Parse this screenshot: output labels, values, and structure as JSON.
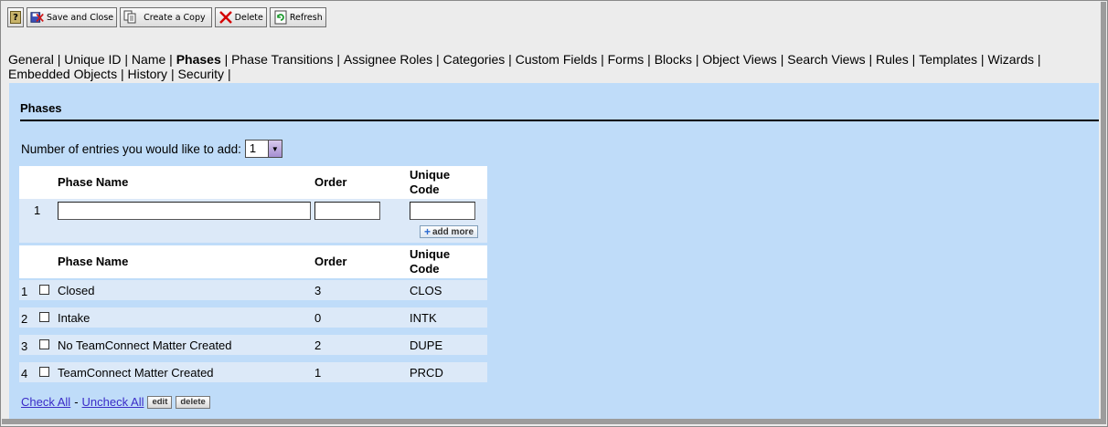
{
  "toolbar": {
    "help_label": "?",
    "save_close_label": "Save and Close",
    "create_copy_label": "Create a Copy",
    "delete_label": "Delete",
    "refresh_label": "Refresh"
  },
  "tabs": [
    {
      "label": "General",
      "active": false
    },
    {
      "label": "Unique ID",
      "active": false
    },
    {
      "label": "Name",
      "active": false
    },
    {
      "label": "Phases",
      "active": true
    },
    {
      "label": "Phase Transitions",
      "active": false
    },
    {
      "label": "Assignee Roles",
      "active": false
    },
    {
      "label": "Categories",
      "active": false
    },
    {
      "label": "Custom Fields",
      "active": false
    },
    {
      "label": "Forms",
      "active": false
    },
    {
      "label": "Blocks",
      "active": false
    },
    {
      "label": "Object Views",
      "active": false
    },
    {
      "label": "Search Views",
      "active": false
    },
    {
      "label": "Rules",
      "active": false
    },
    {
      "label": "Templates",
      "active": false
    },
    {
      "label": "Wizards",
      "active": false
    },
    {
      "label": "Embedded Objects",
      "active": false
    },
    {
      "label": "History",
      "active": false
    },
    {
      "label": "Security",
      "active": false
    }
  ],
  "section": {
    "title": "Phases",
    "entries_label": "Number of entries you would like to add:",
    "entries_value": "1"
  },
  "columns": {
    "name": "Phase Name",
    "order": "Order",
    "code_line1": "Unique",
    "code_line2": "Code"
  },
  "new_entry": {
    "number": "1",
    "add_more_label": "add more"
  },
  "phases": [
    {
      "num": "1",
      "name": "Closed",
      "order": "3",
      "code": "CLOS"
    },
    {
      "num": "2",
      "name": "Intake",
      "order": "0",
      "code": "INTK"
    },
    {
      "num": "3",
      "name": "No TeamConnect Matter Created",
      "order": "2",
      "code": "DUPE"
    },
    {
      "num": "4",
      "name": "TeamConnect Matter Created",
      "order": "1",
      "code": "PRCD"
    }
  ],
  "footer": {
    "check_all": "Check All",
    "separator": "-",
    "uncheck_all": "Uncheck All",
    "edit_label": "edit",
    "delete_label": "delete"
  },
  "colors": {
    "content_bg": "#bfdcf9",
    "row_bg": "#dce9f8",
    "link": "#3a2cc7"
  }
}
